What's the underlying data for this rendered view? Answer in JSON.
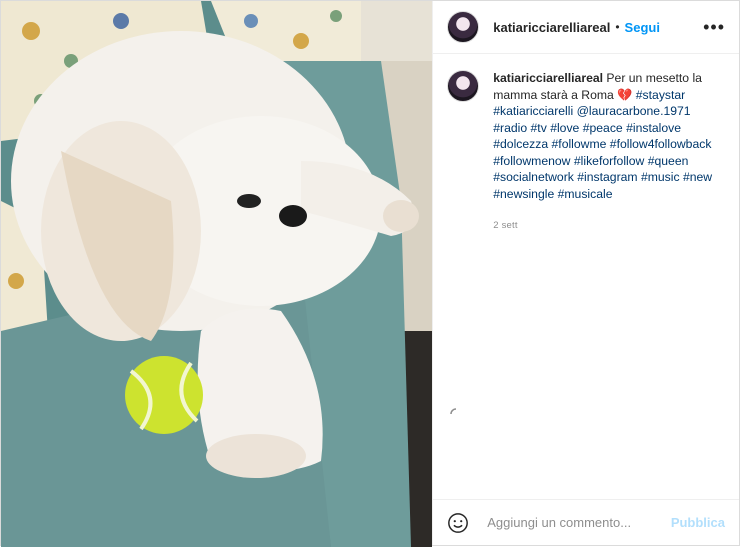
{
  "header": {
    "username": "katiaricciarelliareal",
    "separator": "•",
    "follow_label": "Segui",
    "more_icon": "more-horizontal-icon"
  },
  "caption": {
    "username": "katiaricciarelliareal",
    "text_start": "Per un mesetto la mamma starà a Roma ",
    "emoji": "💔",
    "hashtag_staystar": "#staystar",
    "hashtag_katia": "#katiaricciarelli",
    "mention": "@lauracarbone.1971",
    "hashtags": [
      "#radio",
      "#tv",
      "#love",
      "#peace",
      "#instalove",
      "#dolcezza",
      "#followme",
      "#follow4followback",
      "#followmenow",
      "#likeforfollow",
      "#queen",
      "#socialnetwork",
      "#instagram",
      "#music",
      "#new",
      "#newsingle",
      "#musicale"
    ],
    "time": "2 sett"
  },
  "footer": {
    "placeholder": "Aggiungi un commento...",
    "publish_label": "Pubblica",
    "emoji_icon": "smiley-icon"
  },
  "colors": {
    "accent": "#0095f6",
    "publish_disabled": "#b2dffc",
    "hashtag": "#00376b"
  }
}
